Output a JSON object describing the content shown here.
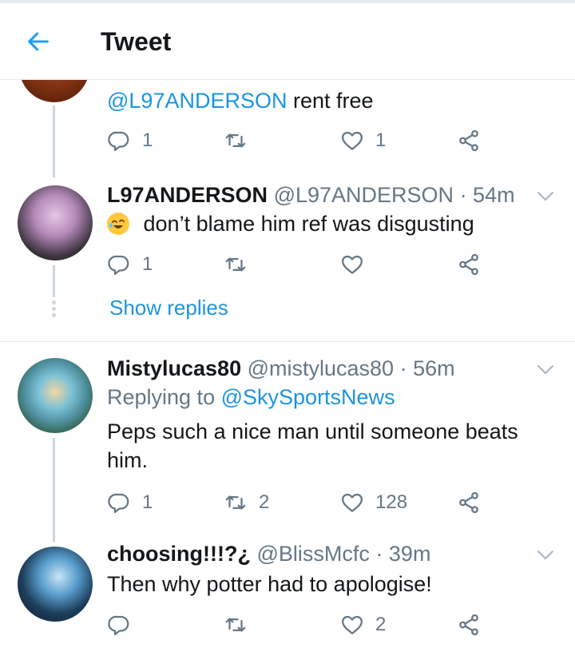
{
  "header": {
    "title": "Tweet",
    "back_icon": "arrow-left-icon"
  },
  "tweets": [
    {
      "text_mention": "@L97ANDERSON",
      "text": "rent free",
      "reply_count": "1",
      "retweet_count": "",
      "like_count": "1"
    },
    {
      "name": "L97ANDERSON",
      "handle": "@L97ANDERSON",
      "time": "· 54m",
      "text": "don’t blame him ref was disgusting",
      "reply_count": "1",
      "retweet_count": "",
      "like_count": "",
      "show_replies": "Show replies"
    },
    {
      "name": "Mistylucas80",
      "handle": "@mistylucas80",
      "time": "· 56m",
      "replying_prefix": "Replying to",
      "replying_to": "@SkySportsNews",
      "text": "Peps such a nice man until someone beats him.",
      "reply_count": "1",
      "retweet_count": "2",
      "like_count": "128"
    },
    {
      "name": "choosing!!!?¿",
      "handle": "@BlissMcfc",
      "time": "· 39m",
      "text": "Then why potter had to apologise!",
      "reply_count": "",
      "retweet_count": "",
      "like_count": "2"
    }
  ],
  "colors": {
    "accent": "#1b95e0",
    "muted": "#657786",
    "divider": "#e6ecf0",
    "emoji": "#ffc83d"
  },
  "icons": [
    "reply-icon",
    "retweet-icon",
    "like-icon",
    "share-icon",
    "chevron-down-icon",
    "laughing-emoji-icon"
  ]
}
